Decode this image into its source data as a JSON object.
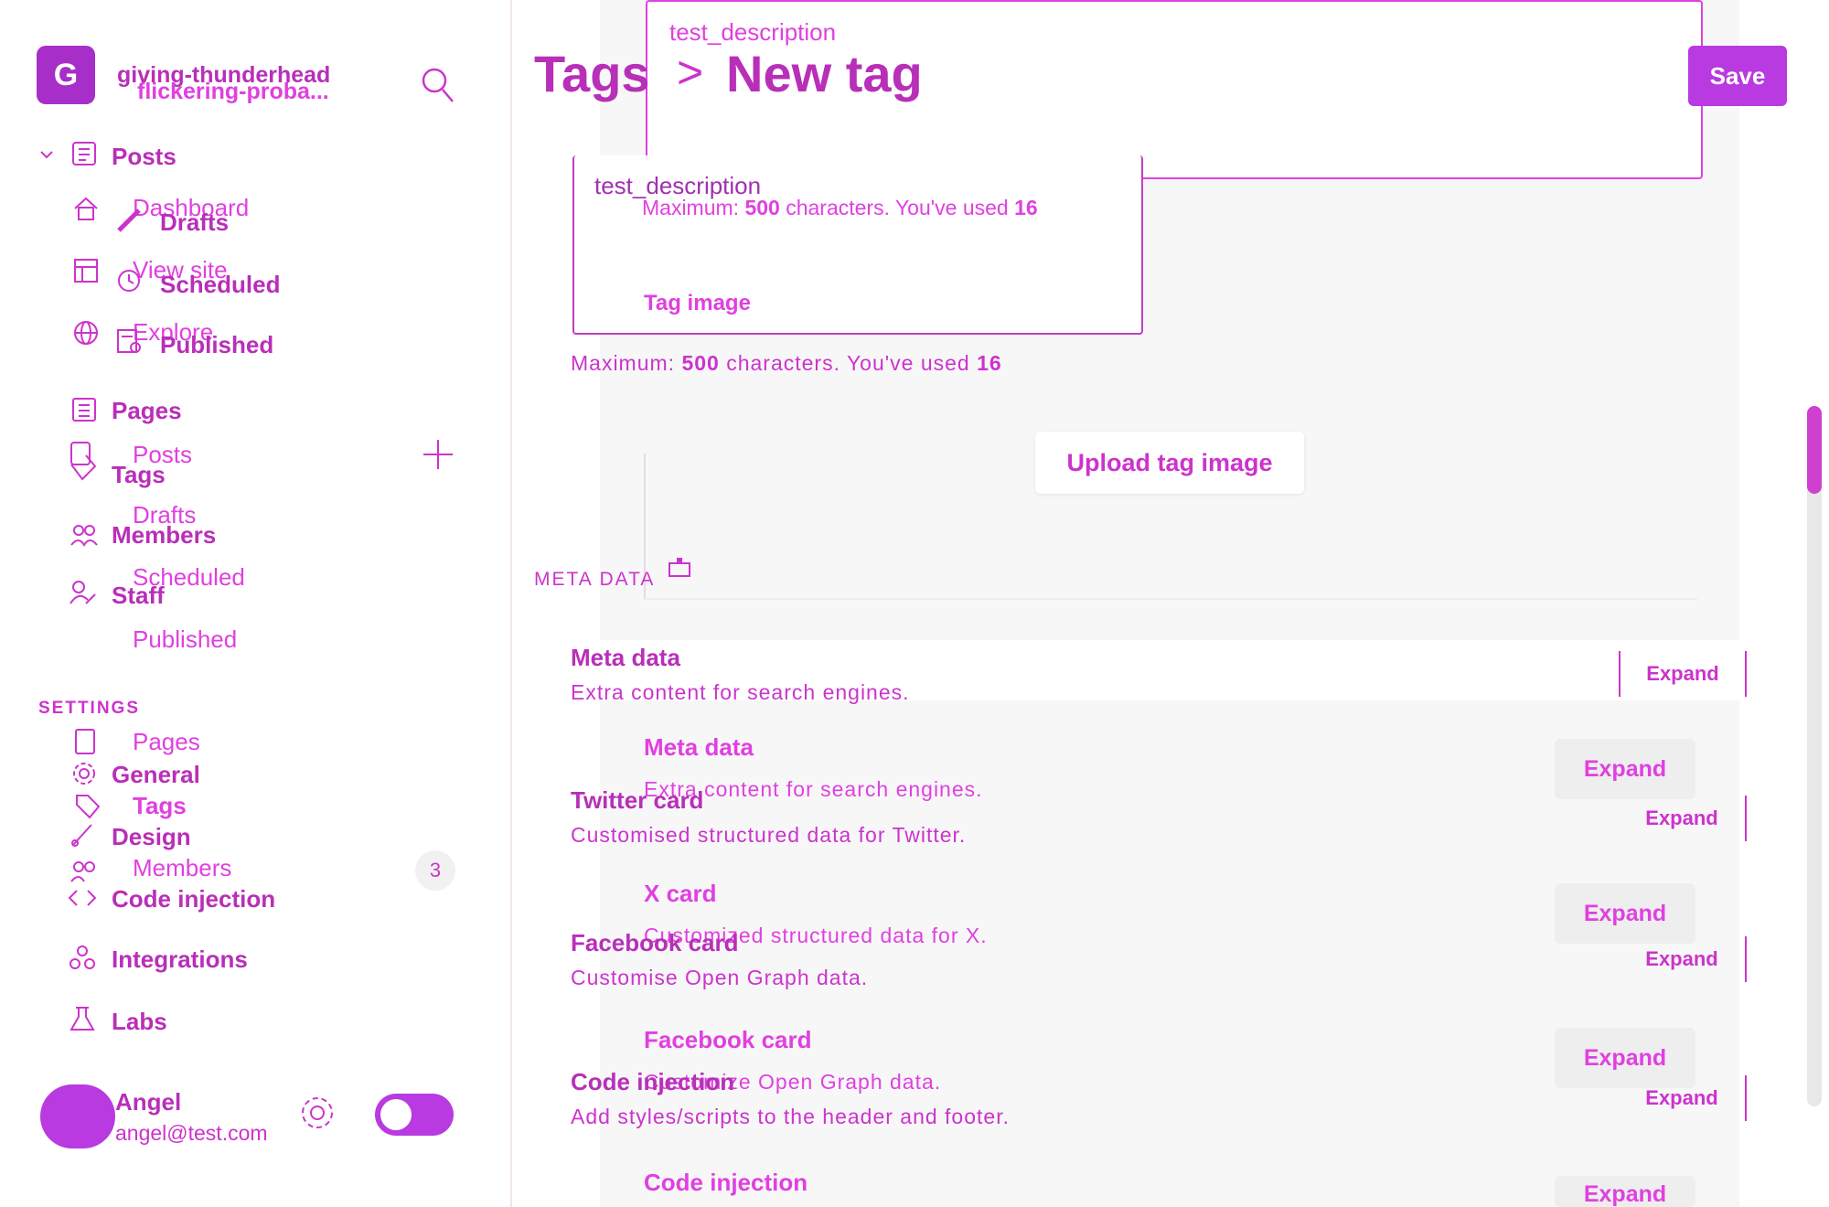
{
  "site": {
    "title_a": "giving-thunderhead",
    "title_b": "flickering-proba...",
    "logo_glyph": "G"
  },
  "sidebar": {
    "posts": "Posts",
    "ghost_items": [
      "Dashboard",
      "View site",
      "Explore"
    ],
    "post_subitems": [
      "Drafts",
      "Scheduled",
      "Published"
    ],
    "pages": "Pages",
    "tags": "Tags",
    "members": "Members",
    "staff": "Staff",
    "ghost_sub": [
      "Posts",
      "Drafts",
      "Scheduled",
      "Published"
    ],
    "settings_heading": "SETTINGS",
    "settings_items": [
      "General",
      "Design",
      "Code injection"
    ],
    "ghost_settings": [
      "Pages",
      "Tags",
      "Members"
    ],
    "members_count": "3",
    "integrations": "Integrations",
    "labs": "Labs",
    "user_name": "Angel",
    "user_email": "angel@test.com"
  },
  "header": {
    "breadcrumb_root": "Tags",
    "breadcrumb_sep": ">",
    "breadcrumb_current": "New tag",
    "save_label": "Save"
  },
  "form": {
    "description_value": "test_description",
    "char_hint_prefix": "Maximum: ",
    "char_max": "500",
    "char_hint_middle": " characters. You've used ",
    "char_used": "16",
    "tag_image_label": "Tag image",
    "upload_label": "Upload tag image"
  },
  "meta_section": {
    "heading": "META DATA",
    "rows": [
      {
        "title": "Meta data",
        "subtitle": "Extra content for search engines.",
        "action": "Expand"
      },
      {
        "title": "Twitter card",
        "subtitle": "Customised structured data for Twitter.",
        "action": "Expand"
      },
      {
        "title": "Facebook card",
        "subtitle": "Customise Open Graph data.",
        "action": "Expand"
      },
      {
        "title": "Code injection",
        "subtitle": "Add styles/scripts to the header and footer.",
        "action": "Expand"
      }
    ],
    "ghost_rows": [
      {
        "title": "Meta data",
        "subtitle": "Extra content for search engines.",
        "action": "Expand"
      },
      {
        "title": "X card",
        "subtitle": "Customized structured data for X.",
        "action": "Expand"
      },
      {
        "title": "Facebook card",
        "subtitle": "Customize Open Graph data.",
        "action": "Expand"
      },
      {
        "title": "Code injection",
        "subtitle": "",
        "action": "Expand"
      }
    ]
  },
  "colors": {
    "accent": "#cc33cc",
    "accent_light": "#e040e0",
    "button_bg": "#b83ae0"
  }
}
